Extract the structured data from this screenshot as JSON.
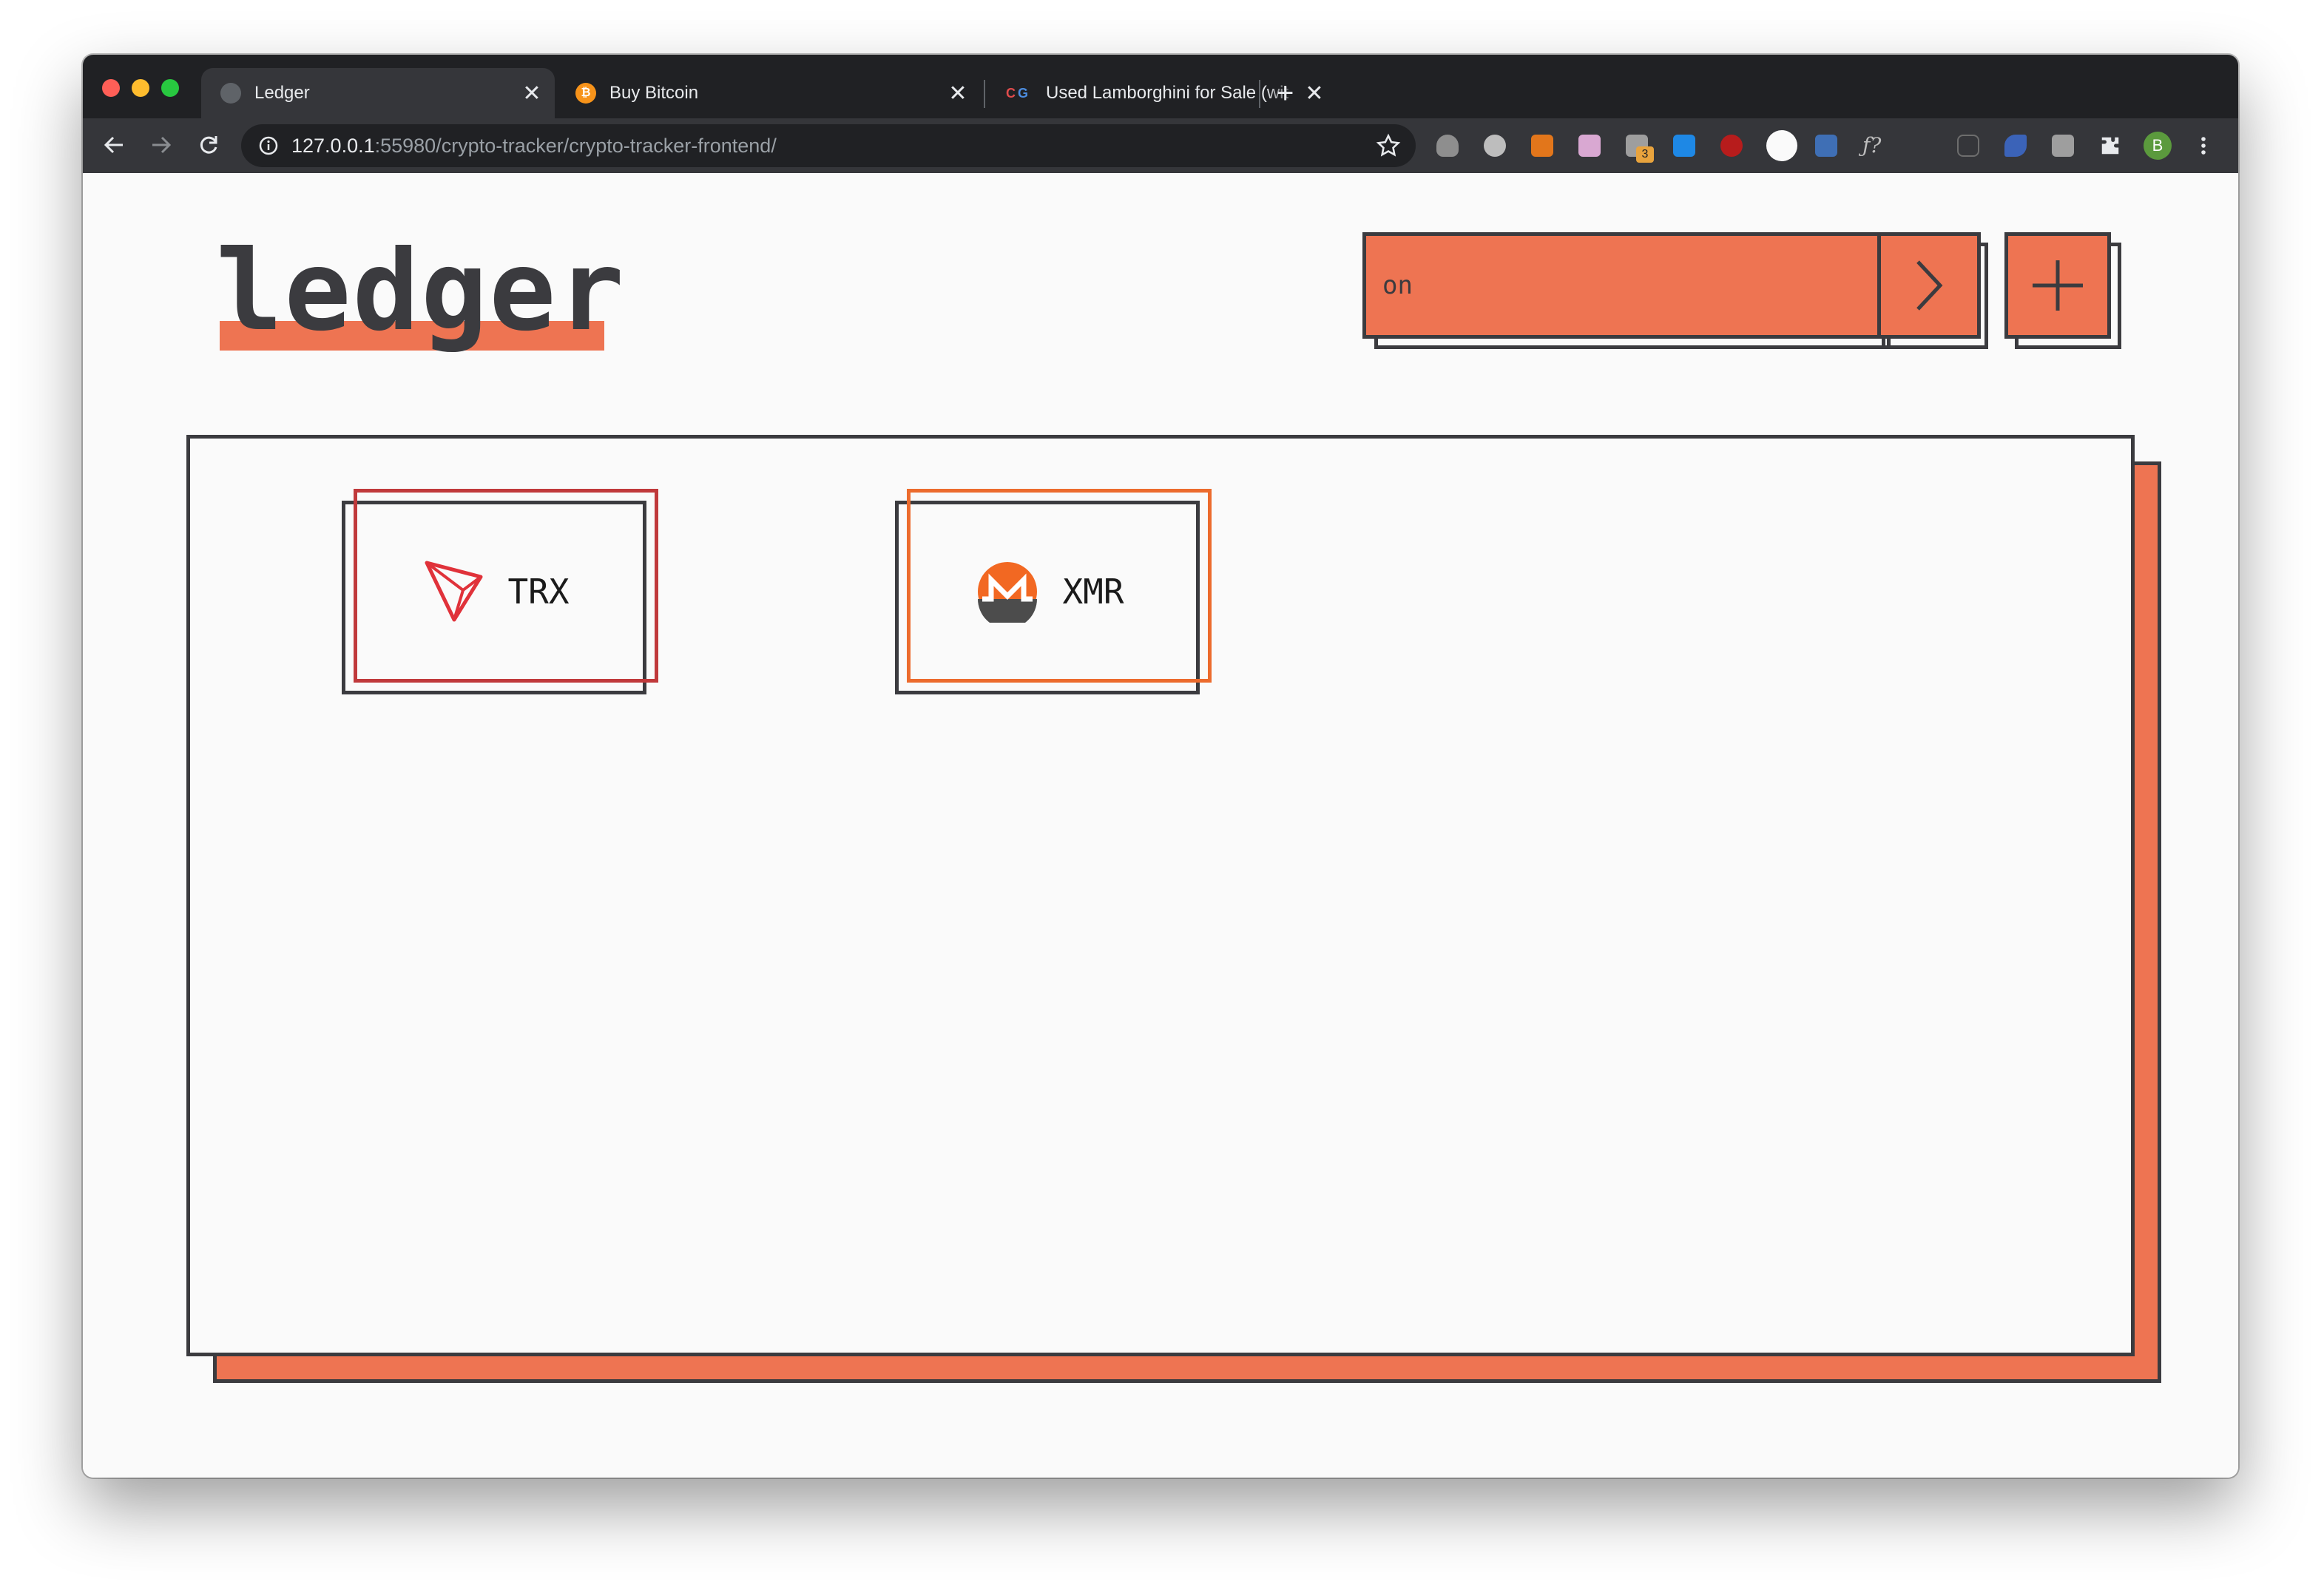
{
  "browser": {
    "tabs": [
      {
        "title": "Ledger",
        "favicon": "globe-icon",
        "active": true
      },
      {
        "title": "Buy Bitcoin",
        "favicon": "bitcoin-icon",
        "active": false
      },
      {
        "title": "Used Lamborghini for Sale (wit",
        "favicon": "coingecko-icon",
        "active": false
      }
    ],
    "tab_close_glyph": "✕",
    "new_tab_glyph": "+",
    "url_host": "127.0.0.1",
    "url_rest": ":55980/crypto-tracker/crypto-tracker-frontend/",
    "profile_initial": "B",
    "extension_badge": "3"
  },
  "app": {
    "logo": "ledger",
    "search": {
      "value": "on",
      "placeholder": ""
    },
    "coins": [
      {
        "symbol": "TRX",
        "icon": "tron-icon",
        "accent": "#c0393b"
      },
      {
        "symbol": "XMR",
        "icon": "monero-icon",
        "accent": "#ec6b2d"
      }
    ]
  },
  "colors": {
    "accent": "#ee7452",
    "ink": "#3b3b3f",
    "background": "#fafafa"
  }
}
